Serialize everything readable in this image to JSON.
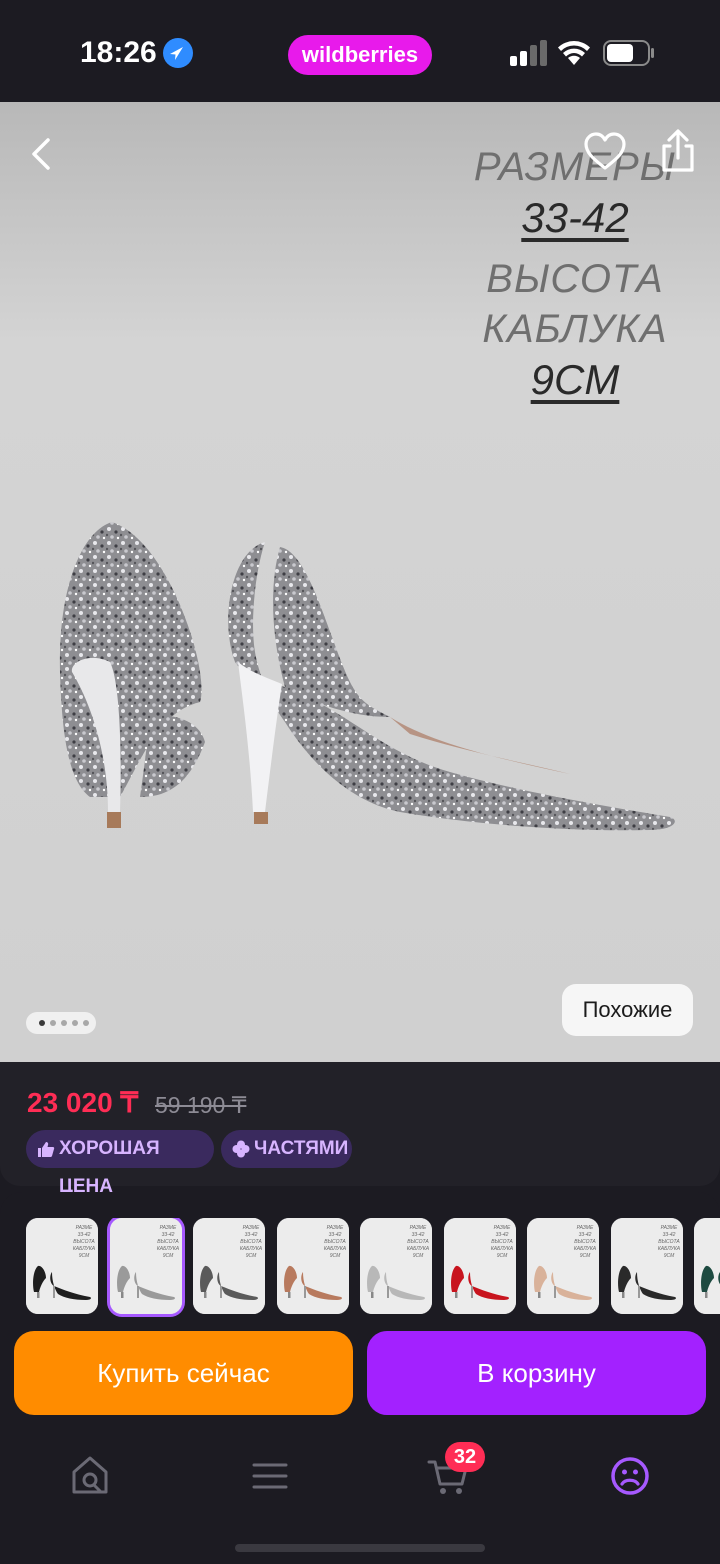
{
  "status_bar": {
    "time": "18:26",
    "brand": "wildberries"
  },
  "gallery": {
    "promo": {
      "sizes_label": "РАЗМЕРЫ",
      "sizes_value": "33-42",
      "heel_label_1": "ВЫСОТА",
      "heel_label_2": "КАБЛУКА",
      "heel_value": "9CM"
    },
    "similar_button": "Похожие",
    "image_count": 5,
    "active_image": 1
  },
  "price": {
    "current": "23 020 ₸",
    "old": "59 190 ₸"
  },
  "badges": [
    {
      "label": "ХОРОШАЯ ЦЕНА",
      "icon": "thumbs-up-icon"
    },
    {
      "label": "ЧАСТЯМИ",
      "icon": "clover-icon"
    }
  ],
  "variants": [
    {
      "color": "black",
      "shoe_color": "#1e1e1e"
    },
    {
      "color": "silver",
      "shoe_color": "#9a9a9a",
      "selected": true
    },
    {
      "color": "gray-glitter",
      "shoe_color": "#5a5a5a"
    },
    {
      "color": "rose-gold",
      "shoe_color": "#b87a5e"
    },
    {
      "color": "silver-glitter",
      "shoe_color": "#b8b8b8"
    },
    {
      "color": "red",
      "shoe_color": "#c8141e"
    },
    {
      "color": "beige",
      "shoe_color": "#d9b29a"
    },
    {
      "color": "black-glitter",
      "shoe_color": "#2a2a2a"
    },
    {
      "color": "green",
      "shoe_color": "#1d4a40"
    }
  ],
  "variant_thumb_text": {
    "line1": "РАЗМЕ",
    "line2": "33-42",
    "line3": "ВЫСОТА",
    "line4": "КАБЛУКА",
    "line5": "9СМ"
  },
  "actions": {
    "buy_now": "Купить сейчас",
    "add_to_cart": "В корзину"
  },
  "tabbar": {
    "cart_count": "32",
    "items": [
      "home-search-icon",
      "menu-icon",
      "cart-icon",
      "profile-icon"
    ]
  },
  "colors": {
    "accent": "#a321ff",
    "buy": "#ff8c00",
    "price": "#ff2d55",
    "brand": "#e81aeb"
  }
}
